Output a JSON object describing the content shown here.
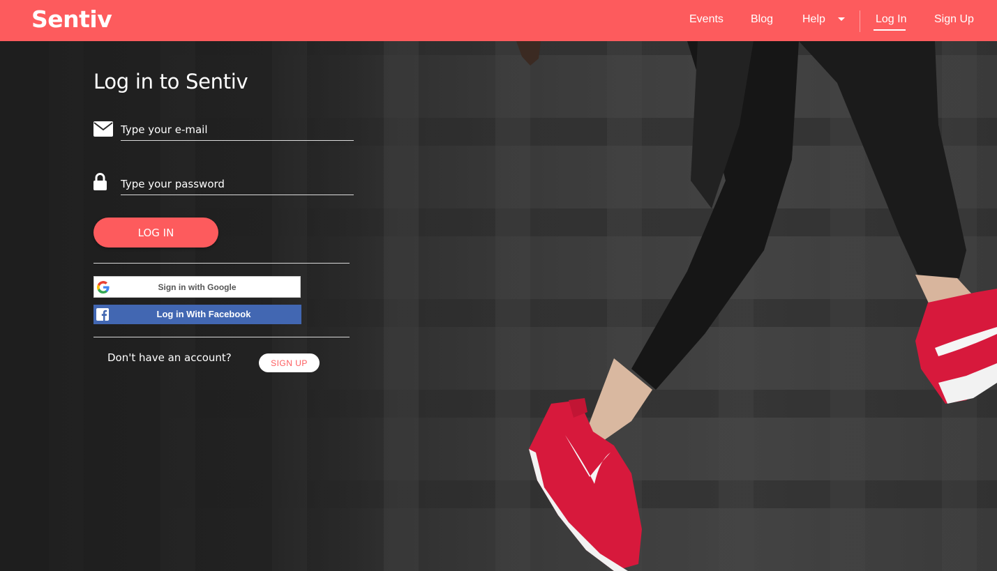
{
  "navbar": {
    "brand": "Sentiv",
    "items": [
      {
        "label": "Events"
      },
      {
        "label": "Blog"
      },
      {
        "label": "Help"
      },
      {
        "label": "Log In"
      },
      {
        "label": "Sign Up"
      }
    ],
    "active_item": "Log In"
  },
  "login": {
    "title": "Log in to Sentiv",
    "email_placeholder": "Type your e-mail",
    "password_placeholder": "Type your password",
    "login_label": "LOG IN",
    "google_label": "Sign in with Google",
    "facebook_label": "Log in With Facebook",
    "no_account_text": "Don't have an account?",
    "signup_label": "SIGN UP"
  },
  "icons": {
    "email": "envelope-icon",
    "password": "lock-icon",
    "google": "google-logo-icon",
    "facebook": "facebook-logo-icon",
    "help_menu": "caret-down-icon"
  },
  "colors": {
    "brand": "#fd5b5d",
    "facebook": "#4267b2",
    "background": "#2a2a2a",
    "sneaker": "#d7193c"
  }
}
